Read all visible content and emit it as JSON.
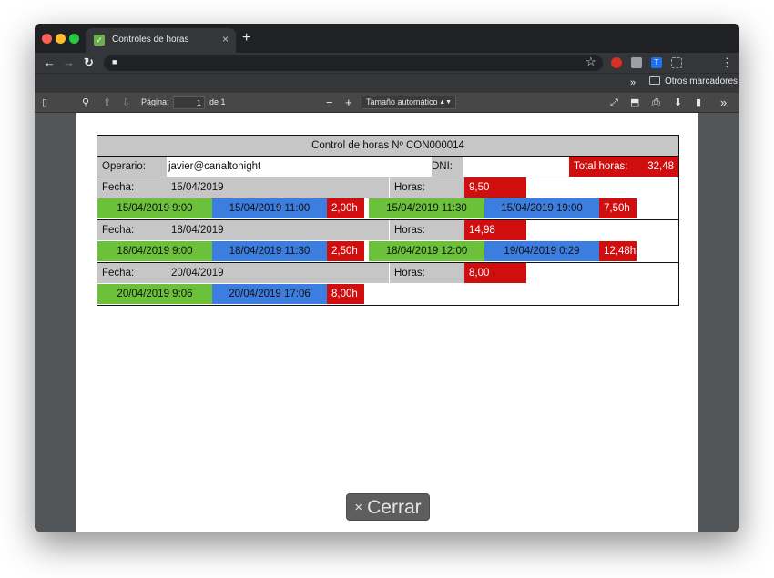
{
  "browser": {
    "tab_title": "Controles de horas",
    "tab_close": "×",
    "new_tab": "+",
    "back": "←",
    "forward": "→",
    "reload": "↻",
    "menu": "⋮",
    "bookmarks_chevron": "»",
    "bookmarks_folder": "Otros marcadores"
  },
  "pdf_toolbar": {
    "page_label": "Página:",
    "page_value": "1",
    "page_of": "de 1",
    "zoom_out": "−",
    "zoom_in": "+",
    "zoom_value": "Tamaño automático",
    "more": "»"
  },
  "report": {
    "title": "Control de horas Nº CON000014",
    "operator_label": "Operario:",
    "operator_value": "javier@canaltonight",
    "dni_label": "DNI:",
    "dni_value": "",
    "total_label": "Total horas:",
    "total_value": "32,48",
    "date_label": "Fecha:",
    "hours_label": "Horas:",
    "days": [
      {
        "date": "15/04/2019",
        "hours": "9,50",
        "s1": {
          "start": "15/04/2019 9:00",
          "end": "15/04/2019 11:00",
          "dur": "2,00h"
        },
        "s2": {
          "start": "15/04/2019 11:30",
          "end": "15/04/2019 19:00",
          "dur": "7,50h"
        }
      },
      {
        "date": "18/04/2019",
        "hours": "14,98",
        "s1": {
          "start": "18/04/2019 9:00",
          "end": "18/04/2019 11:30",
          "dur": "2,50h"
        },
        "s2": {
          "start": "18/04/2019 12:00",
          "end": "19/04/2019 0:29",
          "dur": "12,48h"
        }
      },
      {
        "date": "20/04/2019",
        "hours": "8,00",
        "s1": {
          "start": "20/04/2019 9:06",
          "end": "20/04/2019 17:06",
          "dur": "8,00h"
        }
      }
    ]
  },
  "close_button": {
    "icon": "×",
    "label": "Cerrar"
  },
  "colors": {
    "start": "#6cc13a",
    "end": "#3c7de0",
    "duration": "#d10e0e",
    "label_bg": "#c6c6c6"
  }
}
